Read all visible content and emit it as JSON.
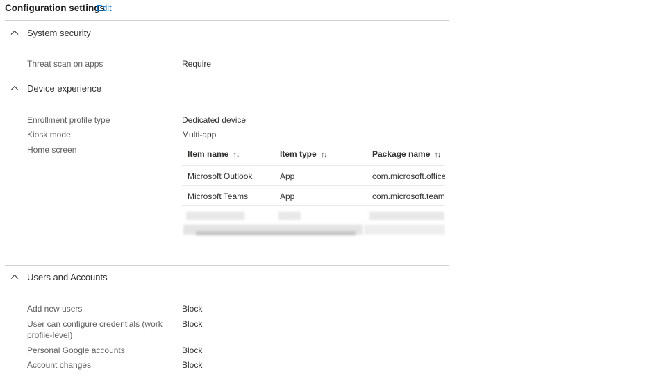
{
  "header": {
    "title": "Configuration settings",
    "edit_label": "Edit"
  },
  "sections": {
    "system_security": {
      "title": "System security",
      "rows": [
        {
          "label": "Threat scan on apps",
          "value": "Require"
        }
      ]
    },
    "device_experience": {
      "title": "Device experience",
      "rows": [
        {
          "label": "Enrollment profile type",
          "value": "Dedicated device"
        },
        {
          "label": "Kiosk mode",
          "value": "Multi-app"
        },
        {
          "label": "Home screen"
        }
      ],
      "table": {
        "columns": [
          {
            "label": "Item name",
            "sort_icon": "↑↓"
          },
          {
            "label": "Item type",
            "sort_icon": "↑↓"
          },
          {
            "label": "Package name",
            "sort_icon": "↑↓"
          }
        ],
        "rows": [
          {
            "name": "Microsoft Outlook",
            "type": "App",
            "package": "com.microsoft.office"
          },
          {
            "name": "Microsoft Teams",
            "type": "App",
            "package": "com.microsoft.teams"
          }
        ]
      }
    },
    "users_accounts": {
      "title": "Users and Accounts",
      "rows": [
        {
          "label": "Add new users",
          "value": "Block"
        },
        {
          "label": "User can configure credentials (work",
          "label_2": "profile-level)",
          "value": "Block"
        },
        {
          "label": "Personal Google accounts",
          "value": "Block"
        },
        {
          "label": "Account changes",
          "value": "Block"
        }
      ]
    }
  },
  "colors": {
    "accent": "#0078d4",
    "divider": "#d2d0ce",
    "label": "#605e5c",
    "text": "#323130"
  }
}
